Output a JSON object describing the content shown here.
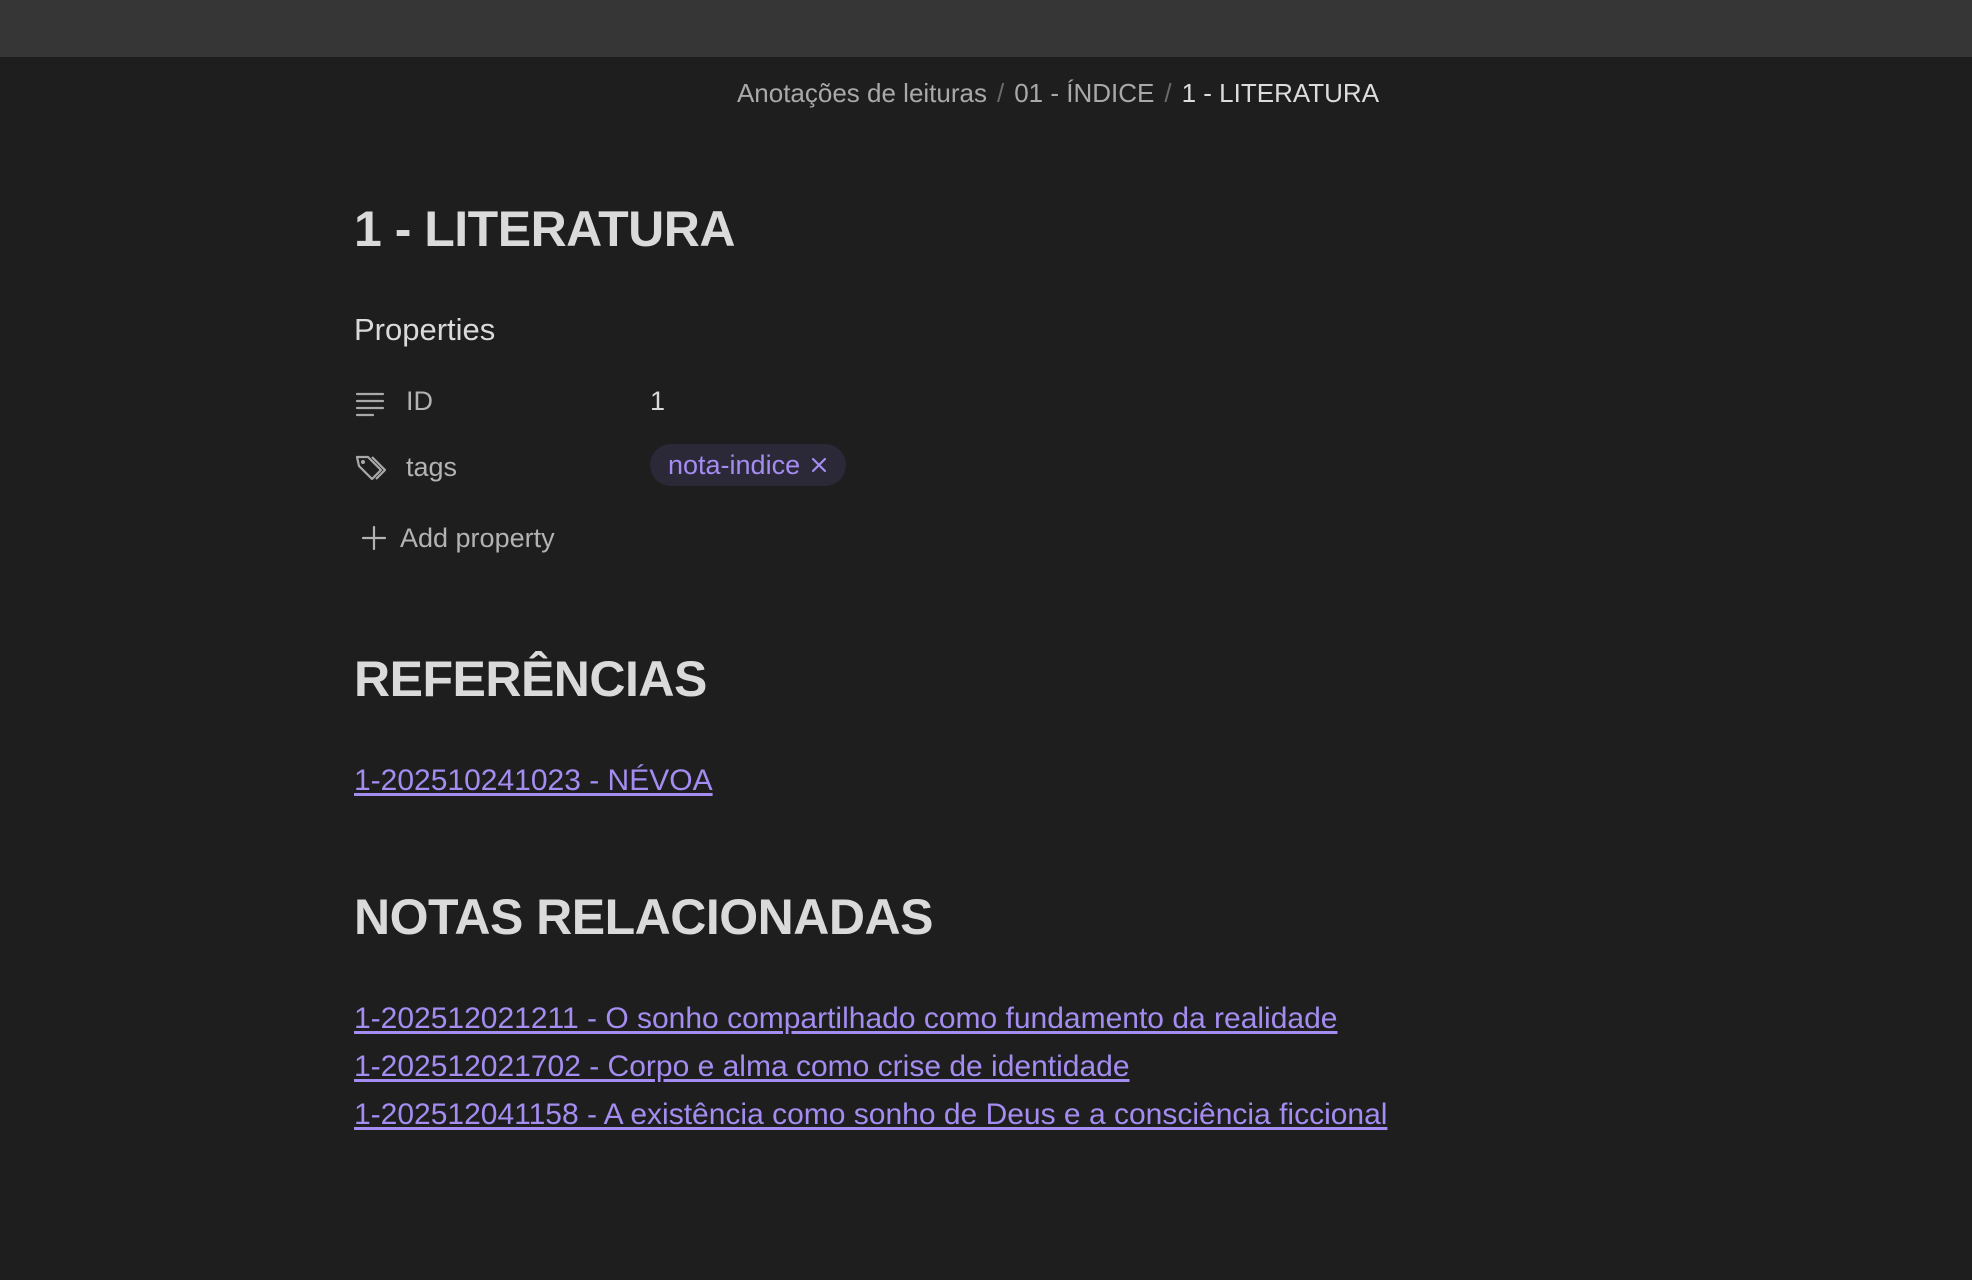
{
  "breadcrumb": {
    "items": [
      "Anotações de leituras",
      "01 - ÍNDICE",
      "1 - LITERATURA"
    ],
    "separator": "/"
  },
  "page": {
    "title": "1 - LITERATURA"
  },
  "properties": {
    "heading": "Properties",
    "rows": [
      {
        "key": "ID",
        "icon": "text-lines-icon",
        "value": "1"
      },
      {
        "key": "tags",
        "icon": "tags-icon",
        "tags": [
          "nota-indice"
        ]
      }
    ],
    "add_label": "Add property"
  },
  "sections": [
    {
      "heading": "REFERÊNCIAS",
      "links": [
        "1-202510241023 - NÉVOA"
      ]
    },
    {
      "heading": "NOTAS RELACIONADAS",
      "links": [
        "1-202512021211 - O sonho compartilhado como fundamento da realidade",
        "1-202512021702 - Corpo e alma como crise de identidade",
        "1-202512041158 - A existência como sonho de Deus e a consciência ficcional"
      ]
    }
  ],
  "colors": {
    "background": "#1e1e1e",
    "topbar": "#363636",
    "accent": "#a48cf0",
    "tag_background": "#2b2838",
    "text": "#dadada",
    "muted": "#b3b3b3"
  }
}
